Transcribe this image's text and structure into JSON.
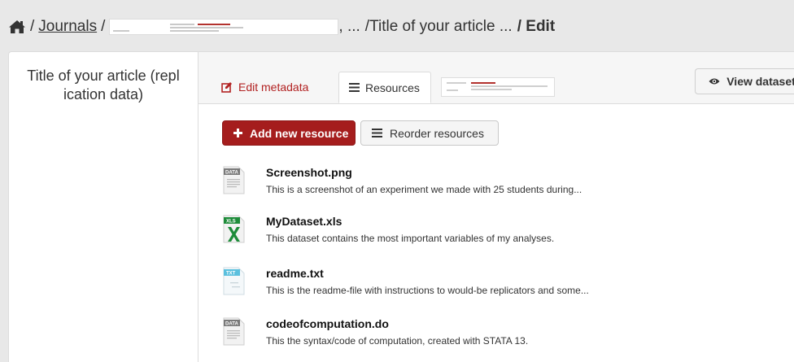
{
  "breadcrumb": {
    "home_icon": "home-icon",
    "separator": "/",
    "journals": "Journals",
    "ellipsis": ", ...",
    "title": "/Title of your article ...",
    "current": "/ Edit"
  },
  "sidebar": {
    "title": "Title of your article (replication data)"
  },
  "tabs": [
    {
      "label": "Edit metadata",
      "icon": "pencil-square-icon",
      "active": false
    },
    {
      "label": "Resources",
      "icon": "bars-icon",
      "active": true
    }
  ],
  "view_dataset": {
    "label": "View dataset",
    "icon": "eye-icon"
  },
  "actions": {
    "add_label": "Add new resource",
    "add_icon": "plus-icon",
    "reorder_label": "Reorder resources",
    "reorder_icon": "bars-icon"
  },
  "resources": [
    {
      "name": "Screenshot.png",
      "description": "This is a screenshot of an experiment we made with 25 students during...",
      "icon_type": "DATA"
    },
    {
      "name": "MyDataset.xls",
      "description": "This dataset contains the most important variables of my analyses.",
      "icon_type": "XLS"
    },
    {
      "name": "readme.txt",
      "description": "This is the readme-file with instructions to would-be replicators and some...",
      "icon_type": "TXT"
    },
    {
      "name": "codeofcomputation.do",
      "description": "This the syntax/code of computation, created with STATA 13.",
      "icon_type": "DATA"
    }
  ],
  "colors": {
    "accent": "#a51d1d",
    "edit_tab": "#b22222",
    "xls_green": "#1e8c3a",
    "txt_blue": "#5bc0de",
    "data_gray": "#7a7a7a"
  }
}
